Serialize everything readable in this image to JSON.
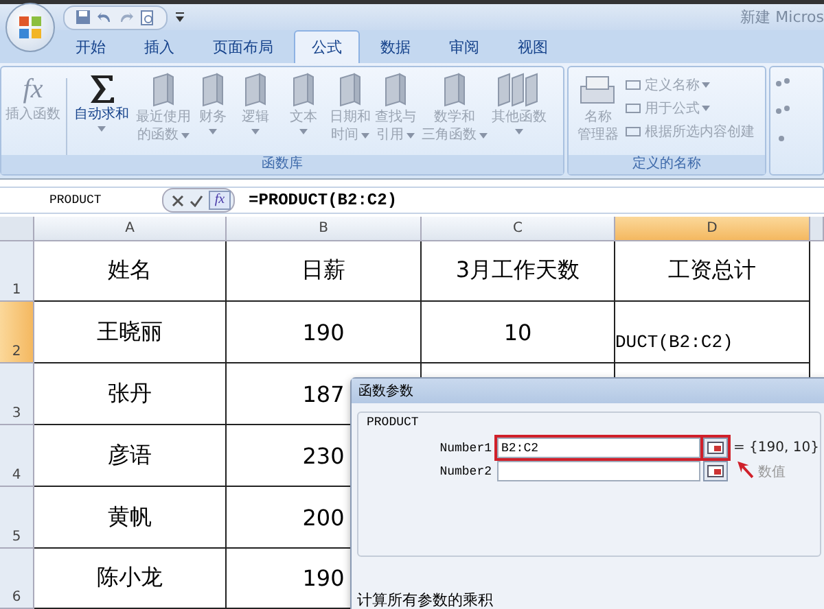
{
  "title_bar": {
    "title": "新建 Micros"
  },
  "tabs": [
    {
      "label": "开始",
      "selected": false
    },
    {
      "label": "插入",
      "selected": false
    },
    {
      "label": "页面布局",
      "selected": false
    },
    {
      "label": "公式",
      "selected": true
    },
    {
      "label": "数据",
      "selected": false
    },
    {
      "label": "审阅",
      "selected": false
    },
    {
      "label": "视图",
      "selected": false
    }
  ],
  "ribbon": {
    "function_library": {
      "label": "函数库",
      "items": [
        {
          "kind": "fx",
          "symbol": "fx",
          "lines": [
            "插入函数"
          ],
          "disabled": true,
          "dropdown": false
        },
        {
          "kind": "sigma",
          "lines": [
            "自动求和"
          ],
          "disabled": false,
          "dropdown": true
        },
        {
          "kind": "book",
          "lines": [
            "最近使用",
            "的函数"
          ],
          "disabled": true,
          "dropdown": true
        },
        {
          "kind": "book",
          "lines": [
            "财务"
          ],
          "disabled": true,
          "dropdown": true
        },
        {
          "kind": "book",
          "lines": [
            "逻辑"
          ],
          "disabled": true,
          "dropdown": true
        },
        {
          "kind": "book",
          "lines": [
            "文本"
          ],
          "disabled": true,
          "dropdown": true
        },
        {
          "kind": "book",
          "lines": [
            "日期和",
            "时间"
          ],
          "disabled": true,
          "dropdown": true
        },
        {
          "kind": "book",
          "lines": [
            "查找与",
            "引用"
          ],
          "disabled": true,
          "dropdown": true
        },
        {
          "kind": "book",
          "lines": [
            "数学和",
            "三角函数"
          ],
          "disabled": true,
          "dropdown": true
        },
        {
          "kind": "books",
          "lines": [
            "其他函数"
          ],
          "disabled": true,
          "dropdown": true
        }
      ]
    },
    "defined_names": {
      "label": "定义的名称",
      "manager": {
        "lines": [
          "名称",
          "管理器"
        ],
        "disabled": true
      },
      "items": [
        {
          "label": "定义名称",
          "dropdown": true,
          "disabled": true
        },
        {
          "label": "用于公式",
          "dropdown": true,
          "disabled": true
        },
        {
          "label": "根据所选内容创建",
          "dropdown": false,
          "disabled": true
        }
      ]
    }
  },
  "formula_bar": {
    "name_box": "PRODUCT",
    "fx_button": "fx",
    "formula": "=PRODUCT(B2:C2)"
  },
  "sheet": {
    "columns": [
      {
        "label": "A",
        "selected": false
      },
      {
        "label": "B",
        "selected": false
      },
      {
        "label": "C",
        "selected": false
      },
      {
        "label": "D",
        "selected": true
      }
    ],
    "rows": [
      {
        "number": "1",
        "selected": false,
        "cells": [
          "姓名",
          "日薪",
          "3月工作天数",
          "工资总计"
        ]
      },
      {
        "number": "2",
        "selected": true,
        "cells": [
          "王晓丽",
          "190",
          "10",
          "DUCT(B2:C2)"
        ]
      },
      {
        "number": "3",
        "selected": false,
        "cells": [
          "张丹",
          "187"
        ]
      },
      {
        "number": "4",
        "selected": false,
        "cells": [
          "彦语",
          "230"
        ]
      },
      {
        "number": "5",
        "selected": false,
        "cells": [
          "黄帆",
          "200"
        ]
      },
      {
        "number": "6",
        "selected": false,
        "cells": [
          "陈小龙",
          "190"
        ]
      }
    ]
  },
  "dialog": {
    "title": "函数参数",
    "function": "PRODUCT",
    "arguments": [
      {
        "label": "Number1",
        "value": "B2:C2",
        "result": "= {190, 10}",
        "highlighted": true
      },
      {
        "label": "Number2",
        "result": "数值",
        "highlighted": false
      }
    ],
    "description": "计算所有参数的乘积"
  }
}
